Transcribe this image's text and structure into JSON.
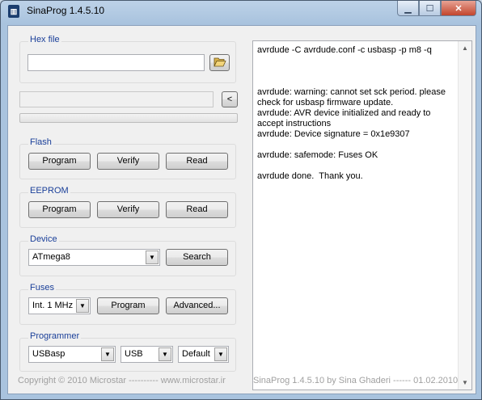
{
  "window": {
    "title": "SinaProg 1.4.5.10",
    "app_icon": "chip-icon"
  },
  "hex_file": {
    "group_label": "Hex file",
    "path_value": "",
    "browse_icon": "open-folder-icon"
  },
  "status_field": {
    "value": "",
    "back_label": "<"
  },
  "flash": {
    "group_label": "Flash",
    "program_label": "Program",
    "verify_label": "Verify",
    "read_label": "Read"
  },
  "eeprom": {
    "group_label": "EEPROM",
    "program_label": "Program",
    "verify_label": "Verify",
    "read_label": "Read"
  },
  "device": {
    "group_label": "Device",
    "selected": "ATmega8",
    "search_label": "Search"
  },
  "fuses": {
    "group_label": "Fuses",
    "selected": "Int. 1 MHz",
    "program_label": "Program",
    "advanced_label": "Advanced..."
  },
  "programmer": {
    "group_label": "Programmer",
    "programmer_selected": "USBasp",
    "port_selected": "USB",
    "speed_selected": "Default"
  },
  "log": {
    "text": "avrdude -C avrdude.conf -c usbasp -p m8 -q\n\n\n\navrdude: warning: cannot set sck period. please check for usbasp firmware update.\navrdude: AVR device initialized and ready to accept instructions\navrdude: Device signature = 0x1e9307\n\navrdude: safemode: Fuses OK\n\navrdude done.  Thank you."
  },
  "footer": {
    "left": "Copyright © 2010 Microstar  ----------  www.microstar.ir",
    "right": "SinaProg 1.4.5.10  by Sina Ghaderi   ------  01.02.2010"
  }
}
